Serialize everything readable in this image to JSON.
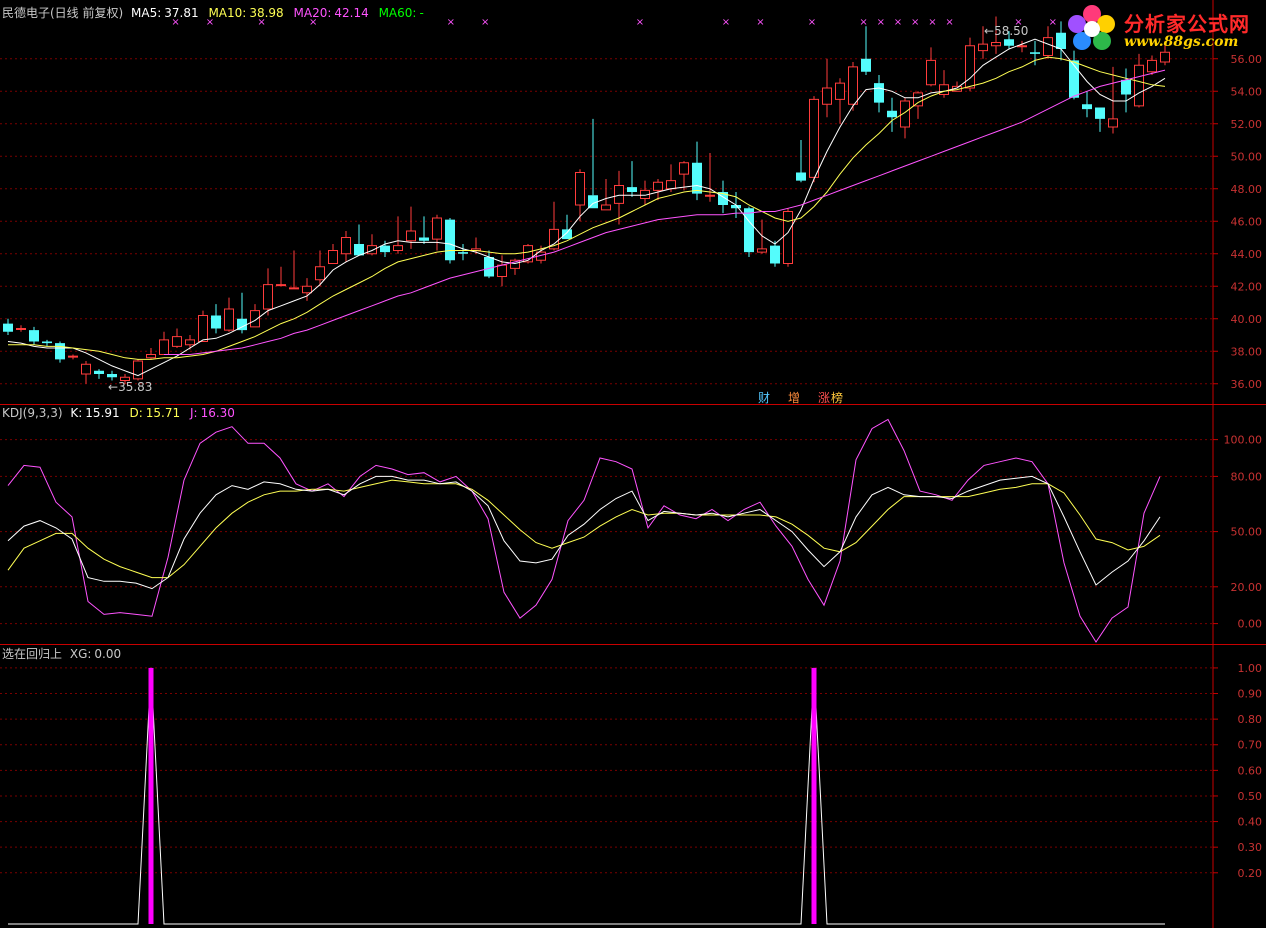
{
  "header": {
    "title": "民德电子(日线 前复权)",
    "ma5_label": "MA5:",
    "ma5_value": "37.81",
    "ma10_label": "MA10:",
    "ma10_value": "38.98",
    "ma20_label": "MA20:",
    "ma20_value": "42.14",
    "ma60_label": "MA60:",
    "ma60_value": "-"
  },
  "kdj_header": {
    "name": "KDJ(9,3,3)",
    "k_label": "K:",
    "k_value": "15.91",
    "d_label": "D:",
    "d_value": "15.71",
    "j_label": "J:",
    "j_value": "16.30"
  },
  "xg_header": {
    "name": "选在回归上",
    "xg_label": "XG:",
    "xg_value": "0.00"
  },
  "annotations": {
    "low": "35.83",
    "high": "58.50"
  },
  "event_tags": {
    "finance": "财",
    "increase": "增",
    "limit": "涨",
    "hot": "榜"
  },
  "logo": {
    "line1": "分析家公式网",
    "line2": "www.88gs.com"
  },
  "colors": {
    "up": "#ff3c3c",
    "down": "#54fcfc",
    "ma5": "#ffffff",
    "ma10": "#ffff54",
    "ma20": "#ff54ff",
    "ma60": "#00c800",
    "grid": "#7a0000",
    "axis": "#c80000",
    "k": "#ffffff",
    "d": "#ffff54",
    "j": "#ff54ff",
    "xg": "#ff00ff"
  },
  "chart_data": [
    {
      "type": "candlestick",
      "ylim": [
        35,
        59
      ],
      "ticks": [
        "36.00",
        "38.00",
        "40.00",
        "42.00",
        "44.00",
        "46.00",
        "48.00",
        "50.00",
        "52.00",
        "54.00",
        "56.00"
      ],
      "candles": [
        [
          39.7,
          39.2,
          40.0,
          39.0
        ],
        [
          39.4,
          39.4,
          39.6,
          39.2
        ],
        [
          39.3,
          38.6,
          39.5,
          38.4
        ],
        [
          38.6,
          38.5,
          38.7,
          38.3
        ],
        [
          38.5,
          37.5,
          38.6,
          37.3
        ],
        [
          37.7,
          37.7,
          37.8,
          37.5
        ],
        [
          36.6,
          37.2,
          37.4,
          36.0
        ],
        [
          36.8,
          36.6,
          36.9,
          36.3
        ],
        [
          36.6,
          36.4,
          36.8,
          36.2
        ],
        [
          36.2,
          36.4,
          36.6,
          36.0
        ],
        [
          36.3,
          37.4,
          37.5,
          36.2
        ],
        [
          37.6,
          37.8,
          38.2,
          37.5
        ],
        [
          37.8,
          38.7,
          39.2,
          37.8
        ],
        [
          38.3,
          38.9,
          39.4,
          38.2
        ],
        [
          38.4,
          38.7,
          39.0,
          38.1
        ],
        [
          38.6,
          40.2,
          40.5,
          38.6
        ],
        [
          40.2,
          39.4,
          40.9,
          39.1
        ],
        [
          39.3,
          40.6,
          41.3,
          39.2
        ],
        [
          40.0,
          39.3,
          41.6,
          39.1
        ],
        [
          39.5,
          40.5,
          40.9,
          39.5
        ],
        [
          40.6,
          42.1,
          43.1,
          40.2
        ],
        [
          42.1,
          42.1,
          43.2,
          42.0
        ],
        [
          41.9,
          41.9,
          44.2,
          41.9
        ],
        [
          41.6,
          42.0,
          42.5,
          41.1
        ],
        [
          42.4,
          43.2,
          44.2,
          42.0
        ],
        [
          43.4,
          44.2,
          44.6,
          43.4
        ],
        [
          44.0,
          45.0,
          45.4,
          43.5
        ],
        [
          44.6,
          43.9,
          45.8,
          43.9
        ],
        [
          44.0,
          44.5,
          45.2,
          43.9
        ],
        [
          44.5,
          44.1,
          44.8,
          43.8
        ],
        [
          44.2,
          44.5,
          46.3,
          44.0
        ],
        [
          44.8,
          45.4,
          46.9,
          44.3
        ],
        [
          45.0,
          44.8,
          46.3,
          44.6
        ],
        [
          44.9,
          46.2,
          46.4,
          44.2
        ],
        [
          46.1,
          43.6,
          46.2,
          43.4
        ],
        [
          44.1,
          44.0,
          44.6,
          43.6
        ],
        [
          44.2,
          44.3,
          45.0,
          44.0
        ],
        [
          43.8,
          42.6,
          44.2,
          42.5
        ],
        [
          42.6,
          43.3,
          43.9,
          42.0
        ],
        [
          43.1,
          43.6,
          43.7,
          42.7
        ],
        [
          43.5,
          44.5,
          44.6,
          43.4
        ],
        [
          43.6,
          44.1,
          44.5,
          43.4
        ],
        [
          44.3,
          45.5,
          47.2,
          44.2
        ],
        [
          45.5,
          44.9,
          46.4,
          45.1
        ],
        [
          47.0,
          49.0,
          49.2,
          46.0
        ],
        [
          47.6,
          46.8,
          52.3,
          47.6
        ],
        [
          46.7,
          47.0,
          48.6,
          46.7
        ],
        [
          47.1,
          48.2,
          49.1,
          45.8
        ],
        [
          48.1,
          47.8,
          49.7,
          47.5
        ],
        [
          47.4,
          47.9,
          48.5,
          47.0
        ],
        [
          47.9,
          48.4,
          48.6,
          47.3
        ],
        [
          48.0,
          48.5,
          49.5,
          47.8
        ],
        [
          48.9,
          49.6,
          49.7,
          47.9
        ],
        [
          49.6,
          47.7,
          50.9,
          47.3
        ],
        [
          47.6,
          47.6,
          50.2,
          47.2
        ],
        [
          47.8,
          47.0,
          48.5,
          46.5
        ],
        [
          47.0,
          46.8,
          47.8,
          46.2
        ],
        [
          46.8,
          44.1,
          46.9,
          43.8
        ],
        [
          44.1,
          44.3,
          46.1,
          44.0
        ],
        [
          44.5,
          43.4,
          44.8,
          43.2
        ],
        [
          43.4,
          46.6,
          46.8,
          43.2
        ],
        [
          49.0,
          48.5,
          51.0,
          48.4
        ],
        [
          48.7,
          53.5,
          53.7,
          48.4
        ],
        [
          53.2,
          54.2,
          56.0,
          52.4
        ],
        [
          53.5,
          54.5,
          54.8,
          52.0
        ],
        [
          53.2,
          55.5,
          55.8,
          52.8
        ],
        [
          56.0,
          55.2,
          58.0,
          55.0
        ],
        [
          54.5,
          53.3,
          55.0,
          52.7
        ],
        [
          52.8,
          52.4,
          53.6,
          51.5
        ],
        [
          51.8,
          53.4,
          53.6,
          51.1
        ],
        [
          53.1,
          53.9,
          54.0,
          52.3
        ],
        [
          54.4,
          55.9,
          56.7,
          54.3
        ],
        [
          53.8,
          54.4,
          55.3,
          53.6
        ],
        [
          54.0,
          54.3,
          54.6,
          54.0
        ],
        [
          54.2,
          56.8,
          57.3,
          54.0
        ],
        [
          56.5,
          56.9,
          58.0,
          56.0
        ],
        [
          56.8,
          57.0,
          58.6,
          56.3
        ],
        [
          57.2,
          56.8,
          57.7,
          56.6
        ],
        [
          56.8,
          56.8,
          57.1,
          56.4
        ],
        [
          56.4,
          56.3,
          57.1,
          55.6
        ],
        [
          56.2,
          57.3,
          58.0,
          56.0
        ],
        [
          57.6,
          56.6,
          58.3,
          55.9
        ],
        [
          55.9,
          53.6,
          56.5,
          53.5
        ],
        [
          53.2,
          52.9,
          54.0,
          52.4
        ],
        [
          53.0,
          52.3,
          52.9,
          51.5
        ],
        [
          51.8,
          52.3,
          55.5,
          51.4
        ],
        [
          54.7,
          53.8,
          55.4,
          52.7
        ],
        [
          53.1,
          55.6,
          56.3,
          53.0
        ],
        [
          55.2,
          55.9,
          56.2,
          55.0
        ],
        [
          55.8,
          56.4,
          57.1,
          55.6
        ]
      ],
      "ma5": [
        38.6,
        38.5,
        38.3,
        38.2,
        38.2,
        38.2,
        37.9,
        37.5,
        37.1,
        36.8,
        36.5,
        36.9,
        37.3,
        37.7,
        38.2,
        38.7,
        38.8,
        39.1,
        39.5,
        39.9,
        40.5,
        40.8,
        41.1,
        41.4,
        42.1,
        43.0,
        43.5,
        43.9,
        44.2,
        44.6,
        44.8,
        44.7,
        44.7,
        44.7,
        44.6,
        44.3,
        44.1,
        43.8,
        43.5,
        43.4,
        43.6,
        44.2,
        44.6,
        45.3,
        46.3,
        47.1,
        47.4,
        47.6,
        47.6,
        47.6,
        47.8,
        48.0,
        48.1,
        48.2,
        48.0,
        47.5,
        47.0,
        46.0,
        45.1,
        44.6,
        45.3,
        46.7,
        48.6,
        50.3,
        51.8,
        53.1,
        54.1,
        54.2,
        54.0,
        53.6,
        53.6,
        53.9,
        54.0,
        54.2,
        54.8,
        55.6,
        56.1,
        56.6,
        56.9,
        57.2,
        56.9,
        56.6,
        55.6,
        54.6,
        53.8,
        53.4,
        53.4,
        53.9,
        54.3,
        54.8
      ],
      "ma10": [
        38.4,
        38.4,
        38.4,
        38.3,
        38.3,
        38.2,
        38.1,
        38.0,
        37.8,
        37.6,
        37.5,
        37.5,
        37.6,
        37.6,
        37.7,
        37.8,
        38.0,
        38.3,
        38.6,
        38.9,
        39.3,
        39.7,
        40.0,
        40.4,
        40.9,
        41.4,
        41.8,
        42.2,
        42.6,
        43.1,
        43.5,
        43.7,
        43.9,
        44.1,
        44.2,
        44.2,
        44.2,
        44.1,
        44.0,
        44.0,
        44.1,
        44.3,
        44.5,
        44.8,
        45.2,
        45.6,
        45.9,
        46.2,
        46.6,
        47.0,
        47.4,
        47.6,
        47.8,
        47.9,
        47.8,
        47.7,
        47.5,
        47.0,
        46.6,
        46.2,
        46.0,
        46.2,
        46.9,
        47.8,
        48.9,
        49.9,
        50.7,
        51.4,
        52.2,
        52.7,
        53.3,
        53.7,
        54.0,
        54.1,
        54.3,
        54.5,
        54.8,
        55.2,
        55.5,
        55.9,
        56.1,
        56.0,
        55.8,
        55.5,
        55.2,
        55.0,
        54.8,
        54.6,
        54.4,
        54.3
      ],
      "ma20": [
        null,
        null,
        null,
        null,
        null,
        null,
        null,
        null,
        null,
        null,
        null,
        null,
        37.8,
        37.8,
        37.8,
        37.9,
        38.0,
        38.1,
        38.2,
        38.4,
        38.6,
        38.8,
        39.1,
        39.3,
        39.6,
        39.9,
        40.2,
        40.5,
        40.8,
        41.1,
        41.4,
        41.6,
        41.9,
        42.2,
        42.5,
        42.7,
        42.9,
        43.1,
        43.3,
        43.5,
        43.7,
        43.9,
        44.1,
        44.4,
        44.7,
        45.0,
        45.3,
        45.5,
        45.7,
        45.9,
        46.1,
        46.2,
        46.3,
        46.4,
        46.4,
        46.4,
        46.5,
        46.5,
        46.6,
        46.6,
        46.8,
        47.0,
        47.3,
        47.6,
        47.9,
        48.2,
        48.5,
        48.8,
        49.1,
        49.4,
        49.7,
        50.0,
        50.3,
        50.6,
        50.9,
        51.2,
        51.5,
        51.8,
        52.1,
        52.5,
        52.9,
        53.3,
        53.7,
        54.0,
        54.3,
        54.5,
        54.7,
        54.9,
        55.1,
        55.3
      ],
      "ma60": [
        null,
        null,
        null,
        null,
        null,
        null,
        null,
        null,
        null,
        null,
        null,
        null,
        null,
        null,
        null,
        null,
        null,
        null,
        null,
        null,
        null,
        null,
        null,
        null,
        null,
        null,
        null,
        null,
        null,
        null,
        null,
        null,
        null,
        null,
        null,
        null,
        null,
        null,
        null,
        null,
        null,
        null,
        null,
        null,
        null,
        null,
        null,
        null,
        null,
        null,
        null,
        null,
        null,
        null,
        null,
        null,
        null,
        null,
        null,
        null,
        null,
        null,
        null,
        null,
        null,
        null,
        null,
        null,
        null,
        null,
        null,
        null,
        null,
        null,
        null,
        null,
        null,
        null,
        null,
        null,
        null,
        null,
        null,
        null,
        null,
        null,
        null,
        null,
        null,
        null
      ]
    },
    {
      "type": "line",
      "title": "KDJ(9,3,3)",
      "ylim": [
        -10,
        115
      ],
      "ticks": [
        "0.00",
        "20.00",
        "50.00",
        "80.00",
        "100.00"
      ],
      "series": [
        {
          "name": "K",
          "values": [
            45,
            53,
            56,
            52,
            46,
            25,
            23,
            23,
            22,
            19,
            25,
            46,
            60,
            70,
            75,
            73,
            77,
            76,
            73,
            72,
            73,
            70,
            76,
            80,
            80,
            78,
            78,
            76,
            77,
            72,
            64,
            45,
            34,
            33,
            35,
            48,
            54,
            62,
            68,
            72,
            56,
            61,
            60,
            59,
            60,
            58,
            60,
            62,
            56,
            50,
            40,
            31,
            39,
            58,
            70,
            74,
            70,
            69,
            69,
            68,
            72,
            75,
            78,
            79,
            80,
            76,
            58,
            39,
            21,
            28,
            34,
            45,
            58
          ]
        },
        {
          "name": "D",
          "values": [
            29,
            41,
            45,
            49,
            49,
            41,
            35,
            31,
            28,
            25,
            25,
            32,
            42,
            52,
            60,
            66,
            70,
            72,
            72,
            73,
            73,
            72,
            74,
            76,
            78,
            77,
            76,
            76,
            76,
            73,
            67,
            59,
            51,
            44,
            41,
            44,
            47,
            53,
            58,
            62,
            59,
            60,
            60,
            59,
            59,
            59,
            59,
            59,
            58,
            54,
            48,
            41,
            39,
            44,
            53,
            62,
            69,
            69,
            69,
            69,
            69,
            71,
            73,
            74,
            76,
            76,
            71,
            59,
            46,
            44,
            40,
            42,
            48
          ]
        },
        {
          "name": "J",
          "values": [
            75,
            86,
            85,
            66,
            58,
            12,
            5,
            6,
            5,
            4,
            36,
            78,
            98,
            104,
            107,
            98,
            98,
            90,
            76,
            72,
            76,
            69,
            80,
            86,
            84,
            81,
            82,
            77,
            80,
            72,
            57,
            17,
            3,
            10,
            24,
            56,
            67,
            90,
            88,
            84,
            52,
            64,
            59,
            57,
            62,
            56,
            62,
            66,
            53,
            42,
            24,
            10,
            34,
            89,
            106,
            111,
            94,
            72,
            70,
            67,
            78,
            86,
            88,
            90,
            88,
            76,
            33,
            4,
            -10,
            3,
            9,
            60,
            80
          ]
        }
      ]
    },
    {
      "type": "line",
      "title": "选在回归上",
      "ylim": [
        0,
        1.07
      ],
      "ticks": [
        "0.20",
        "0.30",
        "0.40",
        "0.50",
        "0.60",
        "0.70",
        "0.80",
        "0.90",
        "1.00"
      ],
      "series": [
        {
          "name": "XG",
          "values": [
            0,
            0,
            0,
            0,
            0,
            0,
            0,
            0,
            0,
            0,
            0,
            1,
            0,
            0,
            0,
            0,
            0,
            0,
            0,
            0,
            0,
            0,
            0,
            0,
            0,
            0,
            0,
            0,
            0,
            0,
            0,
            0,
            0,
            0,
            0,
            0,
            0,
            0,
            0,
            0,
            0,
            0,
            0,
            0,
            0,
            0,
            0,
            0,
            0,
            0,
            0,
            0,
            0,
            0,
            0,
            0,
            0,
            0,
            0,
            0,
            0,
            0,
            1,
            0,
            0,
            0,
            0,
            0,
            0,
            0,
            0,
            0,
            0,
            0,
            0,
            0,
            0,
            0,
            0,
            0,
            0,
            0,
            0,
            0,
            0,
            0,
            0,
            0,
            0,
            0
          ]
        }
      ]
    }
  ]
}
